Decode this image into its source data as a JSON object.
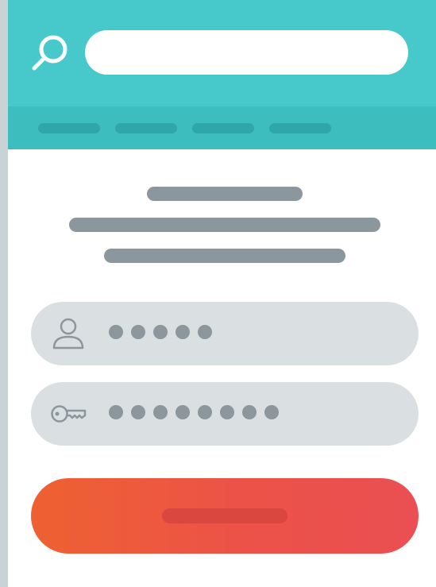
{
  "header": {
    "search": {
      "icon": "search-icon",
      "value": "",
      "placeholder": ""
    },
    "nav_items": [
      "",
      "",
      "",
      ""
    ]
  },
  "intro": {
    "lines": [
      "",
      "",
      ""
    ]
  },
  "login_form": {
    "username": {
      "icon": "user-icon",
      "masked_value": "●●●●●"
    },
    "password": {
      "icon": "key-icon",
      "masked_value": "●●●●●●●●"
    },
    "submit_label": ""
  },
  "colors": {
    "header_bg": "#47c9cb",
    "nav_bg": "#3ebdbe",
    "placeholder_gray": "#8b979c",
    "field_bg": "#dadfe1",
    "button_gradient": [
      "#ee6131",
      "#ea4f52"
    ]
  }
}
